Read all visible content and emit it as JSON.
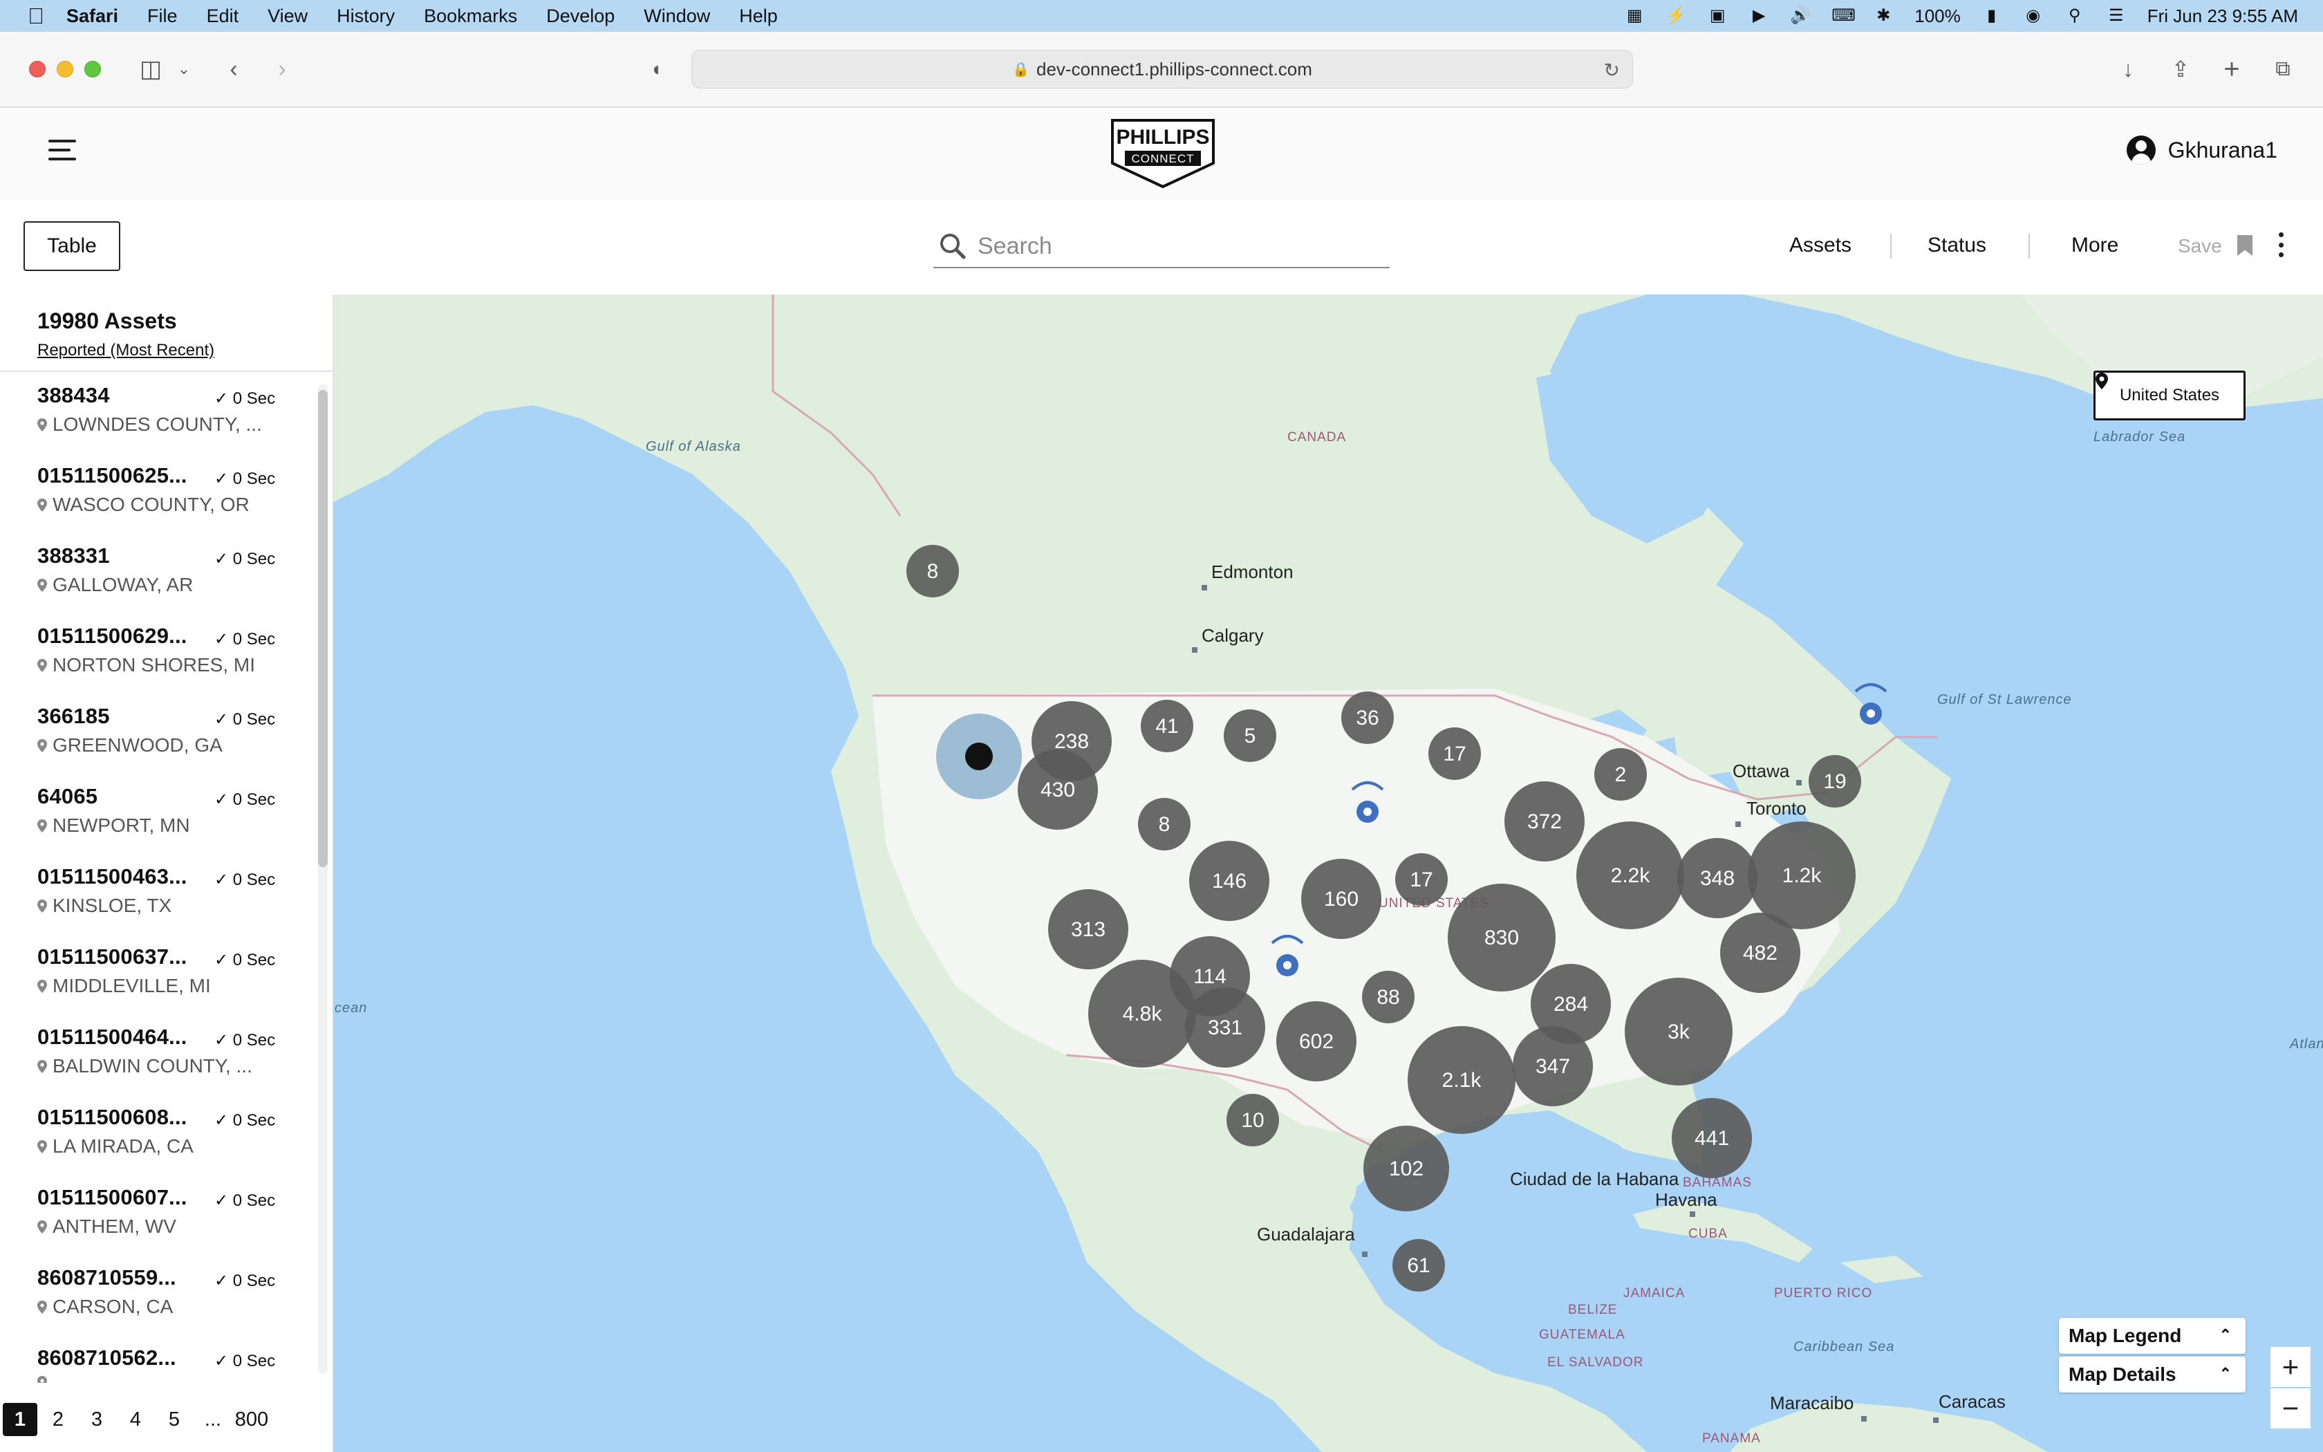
{
  "menubar": {
    "app": "Safari",
    "items": [
      "File",
      "Edit",
      "View",
      "History",
      "Bookmarks",
      "Develop",
      "Window",
      "Help"
    ],
    "battery": "100%",
    "datetime": "Fri Jun 23  9:55 AM"
  },
  "browser": {
    "url": "dev-connect1.phillips-connect.com"
  },
  "header": {
    "logo_line1": "PHILLIPS",
    "logo_line2": "CONNECT",
    "username": "Gkhurana1"
  },
  "filterbar": {
    "table_label": "Table",
    "search_placeholder": "Search",
    "assets_label": "Assets",
    "status_label": "Status",
    "more_label": "More",
    "save_label": "Save"
  },
  "sidebar": {
    "asset_count": "19980 Assets",
    "sort_label": "Reported (Most Recent)",
    "assets": [
      {
        "id": "388434",
        "time": "✓ 0 Sec",
        "location": "LOWNDES COUNTY, ..."
      },
      {
        "id": "01511500625...",
        "time": "✓ 0 Sec",
        "location": "WASCO COUNTY, OR"
      },
      {
        "id": "388331",
        "time": "✓ 0 Sec",
        "location": "GALLOWAY, AR"
      },
      {
        "id": "01511500629...",
        "time": "✓ 0 Sec",
        "location": "NORTON SHORES, MI"
      },
      {
        "id": "366185",
        "time": "✓ 0 Sec",
        "location": "GREENWOOD, GA"
      },
      {
        "id": "64065",
        "time": "✓ 0 Sec",
        "location": "NEWPORT, MN"
      },
      {
        "id": "01511500463...",
        "time": "✓ 0 Sec",
        "location": "KINSLOE, TX"
      },
      {
        "id": "01511500637...",
        "time": "✓ 0 Sec",
        "location": "MIDDLEVILLE, MI"
      },
      {
        "id": "01511500464...",
        "time": "✓ 0 Sec",
        "location": "BALDWIN COUNTY, ..."
      },
      {
        "id": "01511500608...",
        "time": "✓ 0 Sec",
        "location": "LA MIRADA, CA"
      },
      {
        "id": "01511500607...",
        "time": "✓ 0 Sec",
        "location": "ANTHEM, WV"
      },
      {
        "id": "8608710559...",
        "time": "✓ 0 Sec",
        "location": "CARSON, CA"
      },
      {
        "id": "8608710562...",
        "time": "✓ 0 Sec",
        "location": ""
      }
    ],
    "pages": [
      "1",
      "2",
      "3",
      "4",
      "5",
      "...",
      "800"
    ],
    "current_page": "1"
  },
  "map": {
    "region_label": "United States",
    "legend_label": "Map Legend",
    "details_label": "Map Details",
    "cluster_color": "#5a5a5a",
    "selected_color": "#111111",
    "beacon_color": "#3f6fc1",
    "clusters": [
      "8",
      "238",
      "41",
      "5",
      "36",
      "17",
      "430",
      "8",
      "2",
      "19",
      "372",
      "146",
      "17",
      "160",
      "2.2k",
      "348",
      "1.2k",
      "313",
      "830",
      "482",
      "114",
      "88",
      "4.8k",
      "331",
      "284",
      "3k",
      "602",
      "347",
      "2.1k",
      "10",
      "441",
      "102",
      "61"
    ],
    "places": [
      "Edmonton",
      "Calgary",
      "Ottawa",
      "Toronto",
      "Ciudad de la Habana",
      "Havana",
      "Guadalajara",
      "Maracaibo",
      "Caracas"
    ],
    "water": [
      "Gulf of Alaska",
      "Labrador Sea",
      "Gulf of St Lawrence",
      "Caribbean Sea",
      "cean",
      "Atlantic"
    ],
    "countries": [
      "CANADA",
      "UNITED STATES",
      "BAHAMAS",
      "CUBA",
      "JAMAICA",
      "PUERTO RICO",
      "BELIZE",
      "GUATEMALA",
      "EL SALVADOR",
      "PANAMA"
    ]
  }
}
